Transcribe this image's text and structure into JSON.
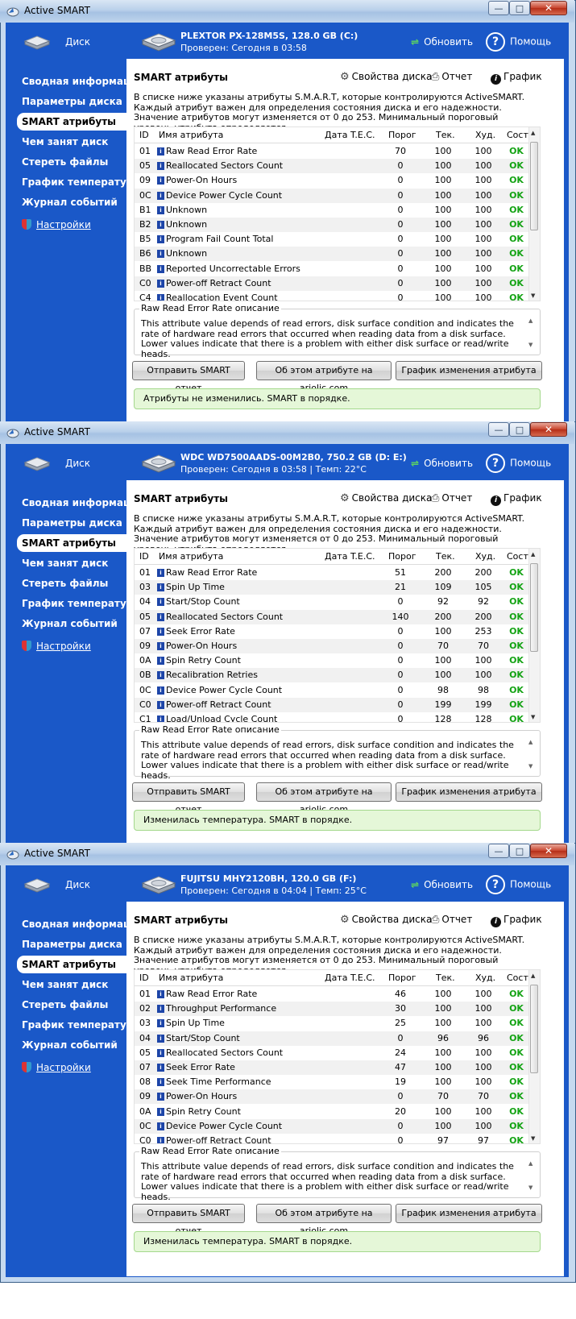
{
  "app_title": "Active SMART",
  "title_controls": {
    "minimize": "—",
    "maximize": "□",
    "close": "✕"
  },
  "toolbar": {
    "disk_label": "Диск",
    "refresh_label": "Обновить",
    "help_label": "Помощь"
  },
  "nav": {
    "items": [
      "Сводная информация",
      "Параметры диска",
      "SMART атрибуты",
      "Чем занят диск",
      "Стереть файлы",
      "График температуры",
      "Журнал событий"
    ],
    "active_index": 2,
    "settings_label": "Настройки"
  },
  "panel": {
    "title": "SMART атрибуты",
    "tools": {
      "properties": "Свойства диска",
      "report": "Отчет",
      "graph": "График"
    },
    "description": "В списке ниже указаны атрибуты S.M.A.R.T, которые контролируются ActiveSMART. Каждый атрибут важен для определения состояния диска и его надежности. Значение атрибутов могут изменяется от 0 до 253. Минимальный пороговый уровень утрибута определяется",
    "columns": {
      "id": "ID",
      "name": "Имя атрибута",
      "date": "Дата T.E.C.",
      "threshold": "Порог",
      "current": "Тек.",
      "worst": "Худ.",
      "state": "Сост."
    },
    "attr_legend": "Raw Read Error Rate описание",
    "attr_text": "This attribute value depends of read errors, disk surface condition and indicates the rate of hardware read errors that occurred when reading data from a disk surface. Lower values indicate that there is a problem with either disk surface or read/write heads.",
    "buttons": {
      "send": "Отправить SMART отчет",
      "about": "Об этом атрибуте на ariolic.com",
      "chart": "График изменения атрибута"
    }
  },
  "windows": [
    {
      "disk_name": "PLEXTOR PX-128M5S, 128.0 GB (C:)",
      "disk_status": "Проверен: Сегодня в 03:58",
      "status_message": "Атрибуты не изменились. SMART в порядке.",
      "rows": [
        [
          "01",
          "Raw Read Error Rate",
          "70",
          "100",
          "100",
          "OK"
        ],
        [
          "05",
          "Reallocated Sectors Count",
          "0",
          "100",
          "100",
          "OK"
        ],
        [
          "09",
          "Power-On Hours",
          "0",
          "100",
          "100",
          "OK"
        ],
        [
          "0C",
          "Device Power Cycle Count",
          "0",
          "100",
          "100",
          "OK"
        ],
        [
          "B1",
          "Unknown",
          "0",
          "100",
          "100",
          "OK"
        ],
        [
          "B2",
          "Unknown",
          "0",
          "100",
          "100",
          "OK"
        ],
        [
          "B5",
          "Program Fail Count Total",
          "0",
          "100",
          "100",
          "OK"
        ],
        [
          "B6",
          "Unknown",
          "0",
          "100",
          "100",
          "OK"
        ],
        [
          "BB",
          "Reported Uncorrectable Errors",
          "0",
          "100",
          "100",
          "OK"
        ],
        [
          "C0",
          "Power-off Retract Count",
          "0",
          "100",
          "100",
          "OK"
        ],
        [
          "C4",
          "Reallocation Event Count",
          "0",
          "100",
          "100",
          "OK"
        ]
      ]
    },
    {
      "disk_name": "WDC WD7500AADS-00M2B0, 750.2 GB (D: E:)",
      "disk_status": "Проверен: Сегодня в 03:58 | Темп: 22°C",
      "status_message": "Изменилась температура. SMART в порядке.",
      "rows": [
        [
          "01",
          "Raw Read Error Rate",
          "51",
          "200",
          "200",
          "OK"
        ],
        [
          "03",
          "Spin Up Time",
          "21",
          "109",
          "105",
          "OK"
        ],
        [
          "04",
          "Start/Stop Count",
          "0",
          "92",
          "92",
          "OK"
        ],
        [
          "05",
          "Reallocated Sectors Count",
          "140",
          "200",
          "200",
          "OK"
        ],
        [
          "07",
          "Seek Error Rate",
          "0",
          "100",
          "253",
          "OK"
        ],
        [
          "09",
          "Power-On Hours",
          "0",
          "70",
          "70",
          "OK"
        ],
        [
          "0A",
          "Spin Retry Count",
          "0",
          "100",
          "100",
          "OK"
        ],
        [
          "0B",
          "Recalibration Retries",
          "0",
          "100",
          "100",
          "OK"
        ],
        [
          "0C",
          "Device Power Cycle Count",
          "0",
          "98",
          "98",
          "OK"
        ],
        [
          "C0",
          "Power-off Retract Count",
          "0",
          "199",
          "199",
          "OK"
        ],
        [
          "C1",
          "Load/Unload Cycle Count",
          "0",
          "128",
          "128",
          "OK"
        ]
      ]
    },
    {
      "disk_name": "FUJITSU MHY2120BH, 120.0 GB (F:)",
      "disk_status": "Проверен: Сегодня в 04:04 | Темп: 25°C",
      "status_message": "Изменилась температура. SMART в порядке.",
      "rows": [
        [
          "01",
          "Raw Read Error Rate",
          "46",
          "100",
          "100",
          "OK"
        ],
        [
          "02",
          "Throughput Performance",
          "30",
          "100",
          "100",
          "OK"
        ],
        [
          "03",
          "Spin Up Time",
          "25",
          "100",
          "100",
          "OK"
        ],
        [
          "04",
          "Start/Stop Count",
          "0",
          "96",
          "96",
          "OK"
        ],
        [
          "05",
          "Reallocated Sectors Count",
          "24",
          "100",
          "100",
          "OK"
        ],
        [
          "07",
          "Seek Error Rate",
          "47",
          "100",
          "100",
          "OK"
        ],
        [
          "08",
          "Seek Time Performance",
          "19",
          "100",
          "100",
          "OK"
        ],
        [
          "09",
          "Power-On Hours",
          "0",
          "70",
          "70",
          "OK"
        ],
        [
          "0A",
          "Spin Retry Count",
          "20",
          "100",
          "100",
          "OK"
        ],
        [
          "0C",
          "Device Power Cycle Count",
          "0",
          "100",
          "100",
          "OK"
        ],
        [
          "C0",
          "Power-off Retract Count",
          "0",
          "97",
          "97",
          "OK"
        ]
      ]
    }
  ]
}
